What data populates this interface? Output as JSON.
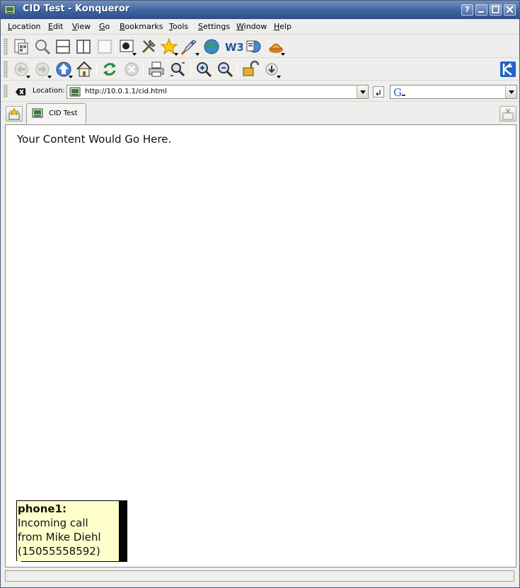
{
  "window": {
    "title": "CID Test - Konqueror",
    "buttons": [
      "?",
      "_",
      "□",
      "✕"
    ]
  },
  "menubar": {
    "items": [
      {
        "label": "Location",
        "mnemonic": "L"
      },
      {
        "label": "Edit",
        "mnemonic": "E"
      },
      {
        "label": "View",
        "mnemonic": "V"
      },
      {
        "label": "Go",
        "mnemonic": "G"
      },
      {
        "label": "Bookmarks",
        "mnemonic": "B"
      },
      {
        "label": "Tools",
        "mnemonic": "T"
      },
      {
        "label": "Settings",
        "mnemonic": "S"
      },
      {
        "label": "Window",
        "mnemonic": "W"
      },
      {
        "label": "Help",
        "mnemonic": "H"
      }
    ]
  },
  "toolbar1_icons": [
    "file-manager-icon",
    "find-icon",
    "split-horizontal-icon",
    "split-vertical-icon",
    "remove-view-icon",
    "view-mode-icon",
    "tools-icon",
    "bookmarks-star-icon",
    "konqueror-rocket-icon",
    "web-globe-icon",
    "w3-validator-icon",
    "translate-icon",
    "gnome-foot-icon"
  ],
  "toolbar2_icons": [
    "back-icon",
    "forward-icon",
    "up-icon",
    "home-icon",
    "reload-icon",
    "stop-icon",
    "print-icon",
    "find-in-page-icon",
    "zoom-in-icon",
    "zoom-out-icon",
    "security-lock-icon",
    "download-icon",
    "kde-logo-icon"
  ],
  "location": {
    "label": "Location:",
    "url": "http://10.0.1.1/cid.html",
    "search_placeholder": ""
  },
  "tabs": [
    {
      "label": "CID Test",
      "active": true
    }
  ],
  "content": {
    "text": "Your Content Would Go Here."
  },
  "notification": {
    "title": "phone1:",
    "lines": [
      "Incoming call",
      "from Mike Diehl",
      "(15055558592)"
    ]
  },
  "colors": {
    "titlebar": "#3f62a0",
    "notification_bg": "#ffffcc",
    "kde_logo": "#1f64c8"
  }
}
